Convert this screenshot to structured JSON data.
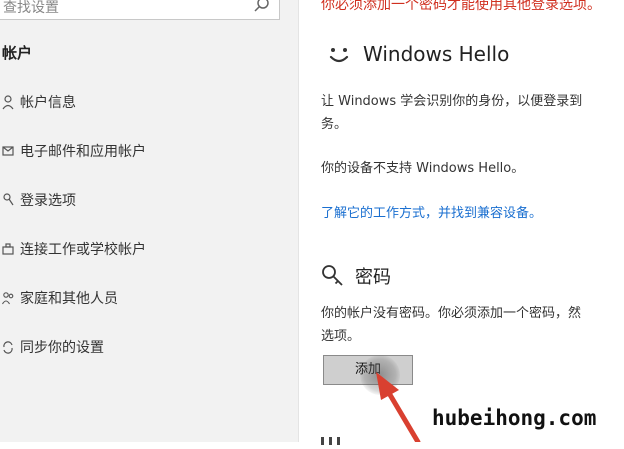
{
  "sidebar": {
    "search_placeholder": "查找设置",
    "section_heading": "帐户",
    "items": [
      {
        "label": "帐户信息",
        "icon": "person-icon"
      },
      {
        "label": "电子邮件和应用帐户",
        "icon": "mail-icon"
      },
      {
        "label": "登录选项",
        "icon": "key-icon"
      },
      {
        "label": "连接工作或学校帐户",
        "icon": "briefcase-icon"
      },
      {
        "label": "家庭和其他人员",
        "icon": "people-icon"
      },
      {
        "label": "同步你的设置",
        "icon": "sync-icon"
      }
    ]
  },
  "main": {
    "top_warning": "你必须添加一个密码才能使用其他登录选项。",
    "hello_title": "Windows Hello",
    "hello_desc_1": "让 Windows 学会识别你的身份，以便登录到",
    "hello_desc_2": "务。",
    "hello_unsupported": "你的设备不支持 Windows Hello。",
    "hello_link": "了解它的工作方式，并找到兼容设备。",
    "password_title": "密码",
    "password_desc_1": "你的帐户没有密码。你必须添加一个密码，然",
    "password_desc_2": "选项。",
    "add_button": "添加"
  },
  "watermark": "hubeihong.com",
  "colors": {
    "warning": "#d03020",
    "link": "#1a6fd0",
    "arrow": "#d94030"
  }
}
